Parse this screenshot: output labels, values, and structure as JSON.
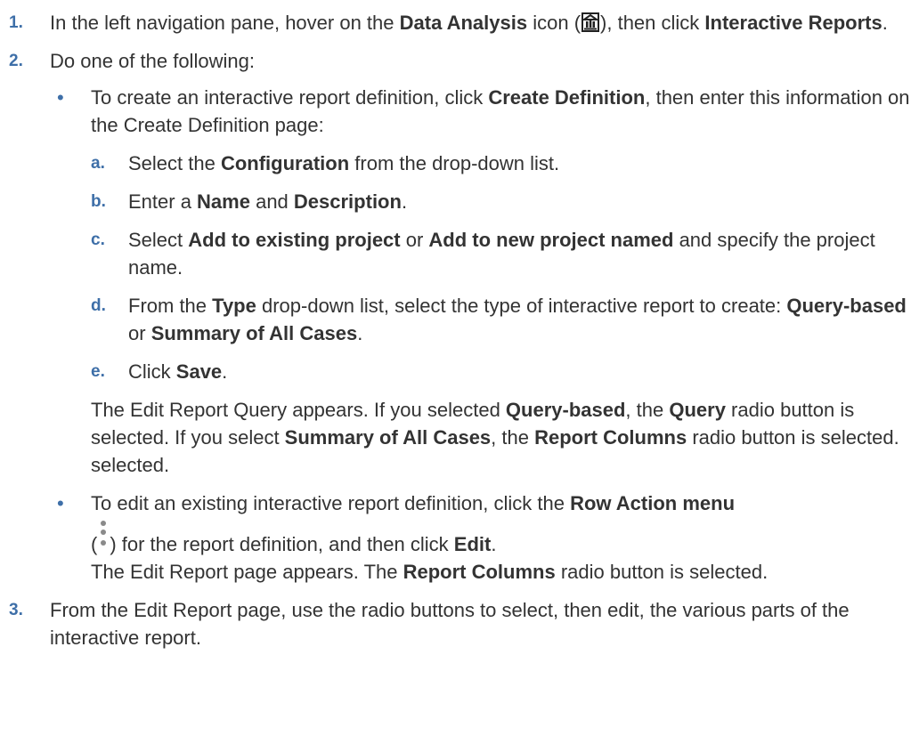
{
  "steps": [
    {
      "num": "1.",
      "t1": "In the left navigation pane, hover on the ",
      "b1": "Data Analysis",
      "t2": " icon (",
      "icon": "data-analysis-icon",
      "t3": "), then click ",
      "b2": "Interactive Reports",
      "t4": "."
    },
    {
      "num": "2.",
      "intro": "Do one of the following:",
      "bullets": [
        {
          "dot": "•",
          "t1": "To create an interactive report definition, click ",
          "b1": "Create Definition",
          "t2": ", then enter this information on the Create Definition page:",
          "substeps": [
            {
              "letter": "a.",
              "t1": "Select the ",
              "b1": "Configuration",
              "t2": " from the drop-down list."
            },
            {
              "letter": "b.",
              "t1": "Enter a ",
              "b1": "Name",
              "t2": " and ",
              "b2": "Description",
              "t3": "."
            },
            {
              "letter": "c.",
              "t1": "Select ",
              "b1": "Add to existing project",
              "t2": " or ",
              "b2": "Add to new project named",
              "t3": " and specify the project name."
            },
            {
              "letter": "d.",
              "t1": "From the ",
              "b1": "Type",
              "t2": " drop-down list, select the type of interactive report to create: ",
              "b2": "Query-based",
              "t3": " or ",
              "b3": "Summary of All Cases",
              "t4": "."
            },
            {
              "letter": "e.",
              "t1": "Click ",
              "b1": "Save",
              "t2": "."
            }
          ],
          "result": {
            "t1": "The Edit Report Query appears. If you selected ",
            "b1": "Query-based",
            "t2": ", the ",
            "b2": "Query",
            "t3": " radio button is selected. If you select ",
            "b3": "Summary of All Cases",
            "t4": ", the ",
            "b4": "Report Columns",
            "t5": " radio button is selected. selected."
          }
        },
        {
          "dot": "•",
          "t1": "To edit an existing interactive report definition, click the ",
          "b1": "Row Action menu",
          "t2": "(",
          "icon": "kebab-menu-icon",
          "t3": ") for the report definition, and then click ",
          "b2": "Edit",
          "t4": ".",
          "result_t1": "The Edit Report page appears. The ",
          "result_b1": "Report Columns",
          "result_t2": " radio button is selected."
        }
      ]
    },
    {
      "num": "3.",
      "t1": "From the Edit Report page, use the radio buttons to select, then edit, the various parts of the interactive report."
    }
  ]
}
